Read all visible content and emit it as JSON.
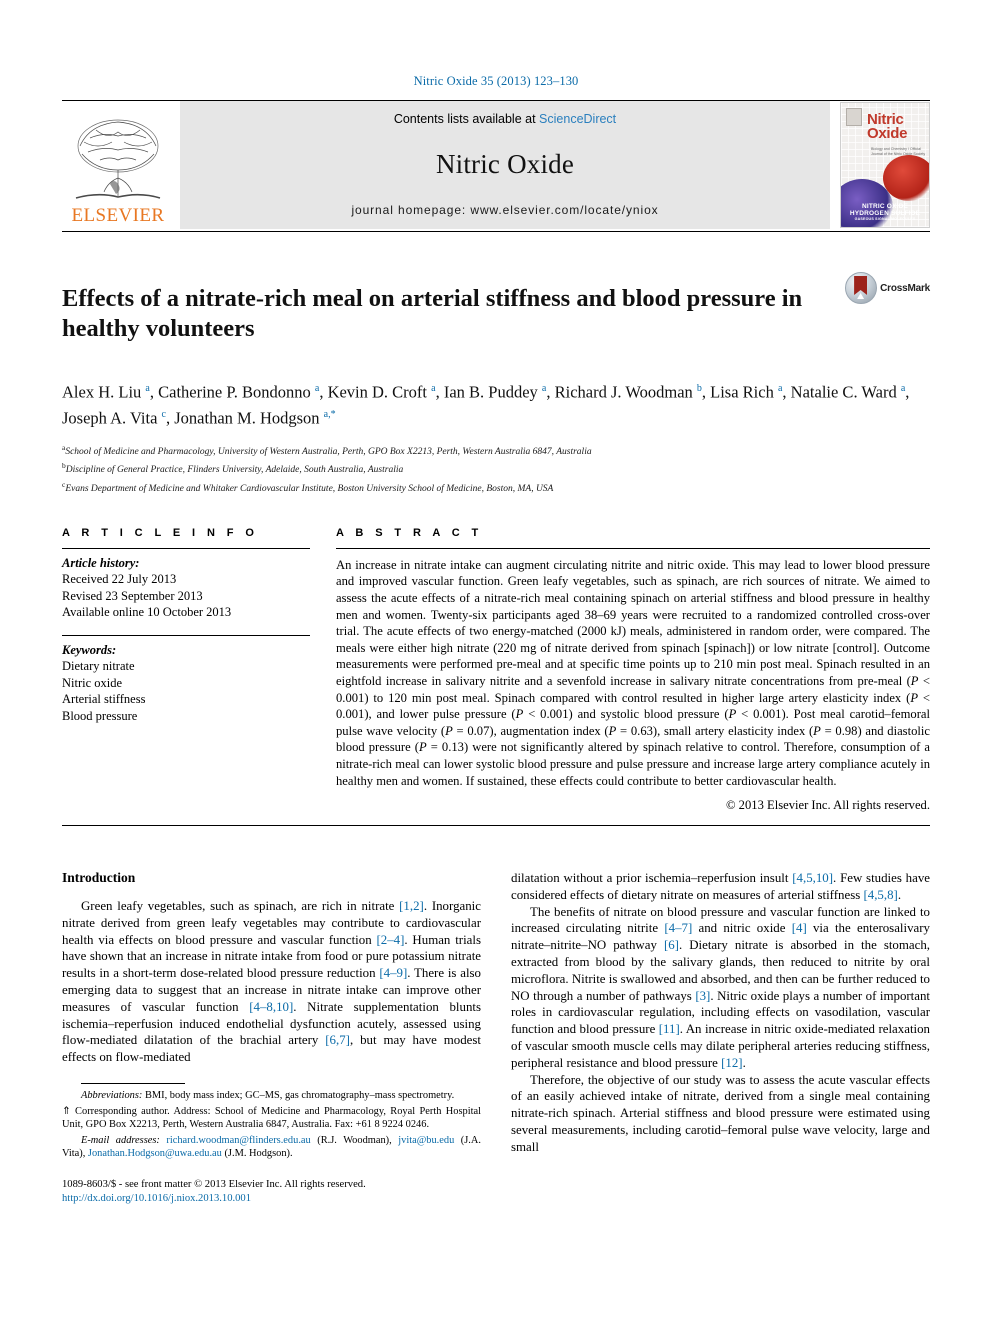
{
  "running_head": "Nitric Oxide 35 (2013) 123–130",
  "masthead": {
    "publisher_name": "ELSEVIER",
    "contents_prefix": "Contents lists available at",
    "contents_link": "ScienceDirect",
    "journal_title": "Nitric Oxide",
    "homepage_line": "journal homepage: www.elsevier.com/locate/yniox",
    "cover": {
      "title_line1": "Nitric",
      "title_line2": "Oxide",
      "subtitle": "Biology and Chemistry / Official Journal of the Nitric Oxide Society",
      "footer_line1": "NITRIC OXIDE",
      "footer_line2": "HYDROGEN SULFIDE",
      "footer_line3": "GASEOUS SIGNAL MOLECULES"
    }
  },
  "article": {
    "title": "Effects of a nitrate-rich meal on arterial stiffness and blood pressure in healthy volunteers",
    "crossmark_label": "CrossMark",
    "authors_html": "Alex H. Liu <sup>a</sup>, Catherine P. Bondonno <sup>a</sup>, Kevin D. Croft <sup>a</sup>, Ian B. Puddey <sup>a</sup>, Richard J. Woodman <sup>b</sup>, Lisa Rich <sup>a</sup>, Natalie C. Ward <sup>a</sup>, Joseph A. Vita <sup>c</sup>, Jonathan M. Hodgson <sup>a,*</sup>",
    "affiliations": [
      {
        "marker": "a",
        "text": "School of Medicine and Pharmacology, University of Western Australia, Perth, GPO Box X2213, Perth, Western Australia 6847, Australia"
      },
      {
        "marker": "b",
        "text": "Discipline of General Practice, Flinders University, Adelaide, South Australia, Australia"
      },
      {
        "marker": "c",
        "text": "Evans Department of Medicine and Whitaker Cardiovascular Institute, Boston University School of Medicine, Boston, MA, USA"
      }
    ]
  },
  "article_info": {
    "heading": "A R T I C L E   I N F O",
    "history_label": "Article history:",
    "history": [
      "Received 22 July 2013",
      "Revised 23 September 2013",
      "Available online 10 October 2013"
    ],
    "keywords_label": "Keywords:",
    "keywords": [
      "Dietary nitrate",
      "Nitric oxide",
      "Arterial stiffness",
      "Blood pressure"
    ]
  },
  "abstract": {
    "heading": "A B S T R A C T",
    "text_html": "An increase in nitrate intake can augment circulating nitrite and nitric oxide. This may lead to lower blood pressure and improved vascular function. Green leafy vegetables, such as spinach, are rich sources of nitrate. We aimed to assess the acute effects of a nitrate-rich meal containing spinach on arterial stiffness and blood pressure in healthy men and women. Twenty-six participants aged 38–69 years were recruited to a randomized controlled cross-over trial. The acute effects of two energy-matched (2000 kJ) meals, administered in random order, were compared. The meals were either high nitrate (220 mg of nitrate derived from spinach [spinach]) or low nitrate [control]. Outcome measurements were performed pre-meal and at specific time points up to 210 min post meal. Spinach resulted in an eightfold increase in salivary nitrite and a sevenfold increase in salivary nitrate concentrations from pre-meal (<i>P</i> &lt; 0.001) to 120 min post meal. Spinach compared with control resulted in higher large artery elasticity index (<i>P</i> &lt; 0.001), and lower pulse pressure (<i>P</i> &lt; 0.001) and systolic blood pressure (<i>P</i> &lt; 0.001). Post meal carotid–femoral pulse wave velocity (<i>P</i> = 0.07), augmentation index (<i>P</i> = 0.63), small artery elasticity index (<i>P</i> = 0.98) and diastolic blood pressure (<i>P</i> = 0.13) were not significantly altered by spinach relative to control. Therefore, consumption of a nitrate-rich meal can lower systolic blood pressure and pulse pressure and increase large artery compliance acutely in healthy men and women. If sustained, these effects could contribute to better cardiovascular health.",
    "copyright": "© 2013 Elsevier Inc. All rights reserved."
  },
  "introduction": {
    "heading": "Introduction",
    "left_paragraph_html": "Green leafy vegetables, such as spinach, are rich in nitrate <span class=\"ref\">[1,2]</span>. Inorganic nitrate derived from green leafy vegetables may contribute to cardiovascular health via effects on blood pressure and vascular function <span class=\"ref\">[2–4]</span>. Human trials have shown that an increase in nitrate intake from food or pure potassium nitrate results in a short-term dose-related blood pressure reduction <span class=\"ref\">[4–9]</span>. There is also emerging data to suggest that an increase in nitrate intake can improve other measures of vascular function <span class=\"ref\">[4–8,10]</span>. Nitrate supplementation blunts ischemia–reperfusion induced endothelial dysfunction acutely, assessed using flow-mediated dilatation of the brachial artery <span class=\"ref\">[6,7]</span>, but may have modest effects on flow-mediated",
    "right_paragraph_1_html": "dilatation without a prior ischemia–reperfusion insult <span class=\"ref\">[4,5,10]</span>. Few studies have considered effects of dietary nitrate on measures of arterial stiffness <span class=\"ref\">[4,5,8]</span>.",
    "right_paragraph_2_html": "The benefits of nitrate on blood pressure and vascular function are linked to increased circulating nitrite <span class=\"ref\">[4–7]</span> and nitric oxide <span class=\"ref\">[4]</span> via the enterosalivary nitrate–nitrite–NO pathway <span class=\"ref\">[6]</span>. Dietary nitrate is absorbed in the stomach, extracted from blood by the salivary glands, then reduced to nitrite by oral microflora. Nitrite is swallowed and absorbed, and then can be further reduced to NO through a number of pathways <span class=\"ref\">[3]</span>. Nitric oxide plays a number of important roles in cardiovascular regulation, including effects on vasodilation, vascular function and blood pressure <span class=\"ref\">[11]</span>. An increase in nitric oxide-mediated relaxation of vascular smooth muscle cells may dilate peripheral arteries reducing stiffness, peripheral resistance and blood pressure <span class=\"ref\">[12]</span>.",
    "right_paragraph_3_html": "Therefore, the objective of our study was to assess the acute vascular effects of an easily achieved intake of nitrate, derived from a single meal containing nitrate-rich spinach. Arterial stiffness and blood pressure were estimated using several measurements, including carotid–femoral pulse wave velocity, large and small"
  },
  "footnotes": {
    "abbreviations_html": "<i>Abbreviations:</i> BMI, body mass index; GC–MS, gas chromatography–mass spectrometry.",
    "corresponding_html": "⇑ Corresponding author. Address: School of Medicine and Pharmacology, Royal Perth Hospital Unit, GPO Box X2213, Perth, Western Australia 6847, Australia. Fax: +61 8 9224 0246.",
    "emails_html": "<i>E-mail addresses:</i> <span class=\"lnk\">richard.woodman@flinders.edu.au</span> (R.J. Woodman), <span class=\"lnk\">jvita@bu.edu</span> (J.A. Vita), <span class=\"lnk\">Jonathan.Hodgson@uwa.edu.au</span> (J.M. Hodgson)."
  },
  "issn_block": {
    "line1": "1089-8603/$ - see front matter © 2013 Elsevier Inc. All rights reserved.",
    "doi": "http://dx.doi.org/10.1016/j.niox.2013.10.001"
  }
}
